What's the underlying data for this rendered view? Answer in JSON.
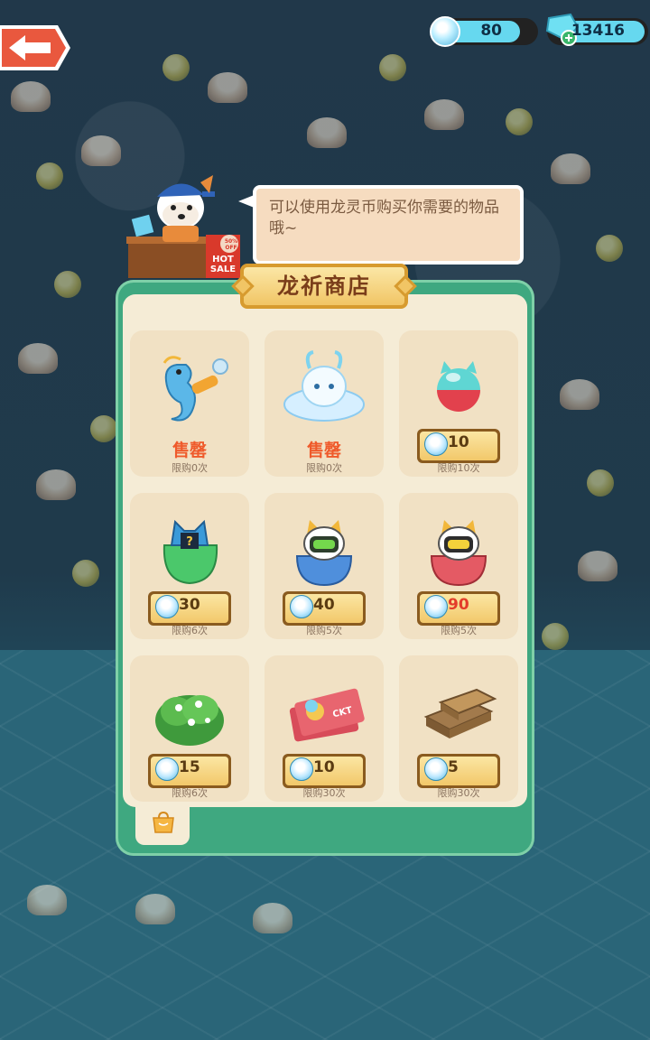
{
  "topbar": {
    "back_icon": "back-arrow-icon",
    "currency_dragon_coin": "80",
    "currency_gem": "13416"
  },
  "npc": {
    "speech": "可以使用龙灵币购买你需要的物品哦~",
    "sign_discount": "50% OFF",
    "sign_text": "HOT SALE"
  },
  "shop": {
    "title": "龙祈商店",
    "items": [
      {
        "name": "seahorse-icon",
        "status": "售罄",
        "price": null,
        "limit": "限购0次"
      },
      {
        "name": "cloud-dragon-icon",
        "status": "售罄",
        "price": null,
        "limit": "限购0次"
      },
      {
        "name": "cat-capsule-icon",
        "status": null,
        "price": "10",
        "limit": "限购10次"
      },
      {
        "name": "mystery-bag-icon",
        "status": null,
        "price": "30",
        "limit": "限购6次"
      },
      {
        "name": "green-robot-cat-icon",
        "status": null,
        "price": "40",
        "limit": "限购5次"
      },
      {
        "name": "yellow-robot-cat-icon",
        "status": null,
        "price": "90",
        "price_color": "#e33c2a",
        "limit": "限购5次"
      },
      {
        "name": "bush-icon",
        "status": null,
        "price": "15",
        "limit": "限购6次"
      },
      {
        "name": "ticket-icon",
        "status": null,
        "price": "10",
        "limit": "限购30次"
      },
      {
        "name": "wood-planks-icon",
        "status": null,
        "price": "5",
        "limit": "限购30次"
      }
    ],
    "bag_icon": "bag-icon"
  }
}
